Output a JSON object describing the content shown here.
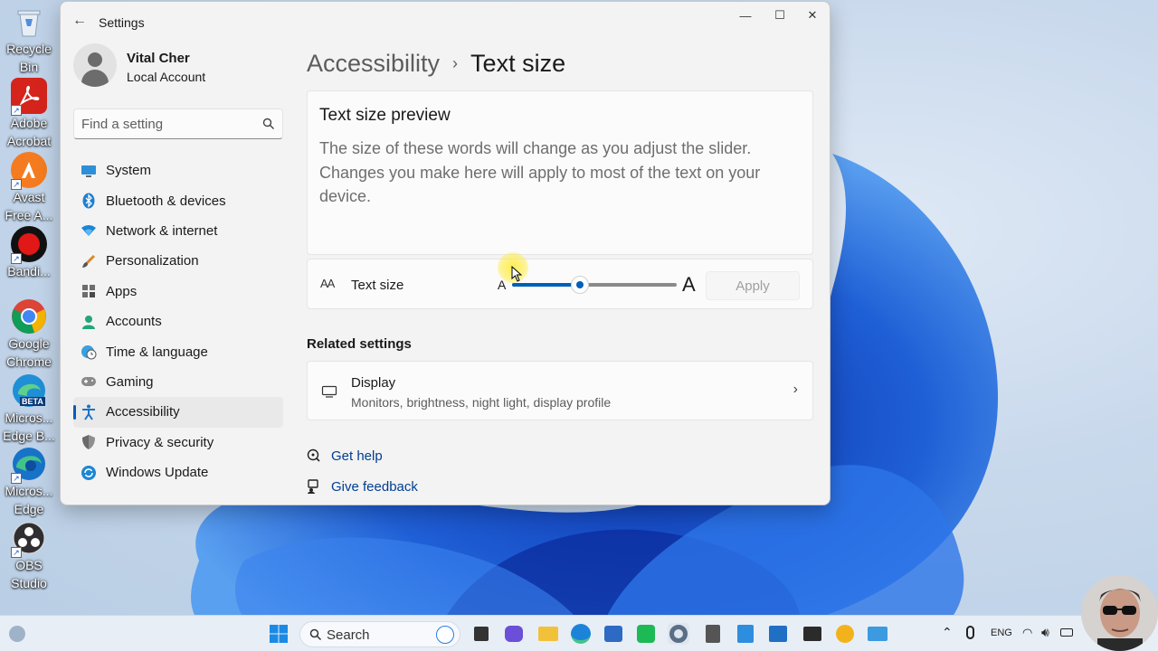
{
  "desktop": {
    "icons": [
      {
        "label": "Recycle\nBin",
        "icon": "recycle-bin-icon"
      },
      {
        "label": "Adobe\nAcrobat",
        "icon": "adobe-acrobat-icon"
      },
      {
        "label": "Avast\nFree A...",
        "icon": "avast-icon"
      },
      {
        "label": "Bandi...",
        "icon": "bandicam-icon"
      },
      {
        "label": "Google\nChrome",
        "icon": "chrome-icon"
      },
      {
        "label": "Micros...\nEdge B...",
        "icon": "edge-beta-icon"
      },
      {
        "label": "Micros...\nEdge",
        "icon": "edge-icon"
      },
      {
        "label": "OBS\nStudio",
        "icon": "obs-icon"
      }
    ],
    "edge_beta_badge": "BETA"
  },
  "window": {
    "title": "Settings",
    "controls": {
      "minimize": "—",
      "maximize": "☐",
      "close": "✕"
    }
  },
  "profile": {
    "name": "Vital Cher",
    "account_type": "Local Account"
  },
  "search": {
    "placeholder": "Find a setting"
  },
  "nav": {
    "items": [
      {
        "label": "System",
        "icon": "system-icon"
      },
      {
        "label": "Bluetooth & devices",
        "icon": "bluetooth-icon"
      },
      {
        "label": "Network & internet",
        "icon": "wifi-icon"
      },
      {
        "label": "Personalization",
        "icon": "brush-icon"
      },
      {
        "label": "Apps",
        "icon": "apps-icon"
      },
      {
        "label": "Accounts",
        "icon": "accounts-icon"
      },
      {
        "label": "Time & language",
        "icon": "globe-clock-icon"
      },
      {
        "label": "Gaming",
        "icon": "gamepad-icon"
      },
      {
        "label": "Accessibility",
        "icon": "accessibility-icon",
        "active": true
      },
      {
        "label": "Privacy & security",
        "icon": "shield-icon"
      },
      {
        "label": "Windows Update",
        "icon": "update-icon"
      }
    ]
  },
  "breadcrumb": {
    "parent": "Accessibility",
    "separator": "›",
    "current": "Text size"
  },
  "preview": {
    "title": "Text size preview",
    "text": "The size of these words will change as you adjust the slider. Changes you make here will apply to most of the text on your device."
  },
  "text_size": {
    "icon_text": "AA",
    "label": "Text size",
    "small_label": "A",
    "large_label": "A",
    "slider_fraction": 0.41,
    "apply_label": "Apply"
  },
  "related": {
    "heading": "Related settings",
    "display": {
      "title": "Display",
      "subtitle": "Monitors, brightness, night light, display profile",
      "chevron": "›"
    }
  },
  "links": {
    "help": "Get help",
    "feedback": "Give feedback"
  },
  "taskbar": {
    "search_label": "Search",
    "language": "ENG",
    "apps": [
      "start-icon",
      "search-icon",
      "task-view-icon",
      "chat-icon",
      "file-explorer-icon",
      "edge-icon",
      "store-icon",
      "xbox-icon",
      "settings-icon",
      "calculator-icon",
      "notepad-icon",
      "calendar-icon",
      "terminal-icon",
      "canary-icon",
      "remote-desktop-icon"
    ]
  },
  "colors": {
    "accent": "#005fb8",
    "link": "#003e92",
    "wallpaper_blue": "#1f5fd6"
  }
}
